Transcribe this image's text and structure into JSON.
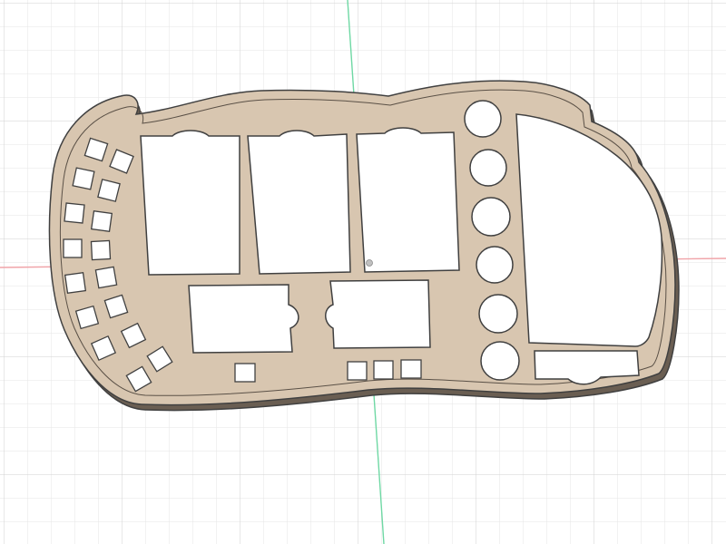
{
  "viewport": {
    "background_color": "#ffffff",
    "grid_minor_color": "#e6e6e6",
    "grid_major_color": "#d2d2d2",
    "x_axis_color": "#f0a3a8",
    "y_axis_color": "#6fd8a4"
  },
  "model": {
    "body_color": "#d8c6b0",
    "edge_color": "#404040",
    "shadow_color": "#6a5e52",
    "cutout_color": "#ffffff",
    "axis_origin_marker_color": "#c0c0c0"
  }
}
